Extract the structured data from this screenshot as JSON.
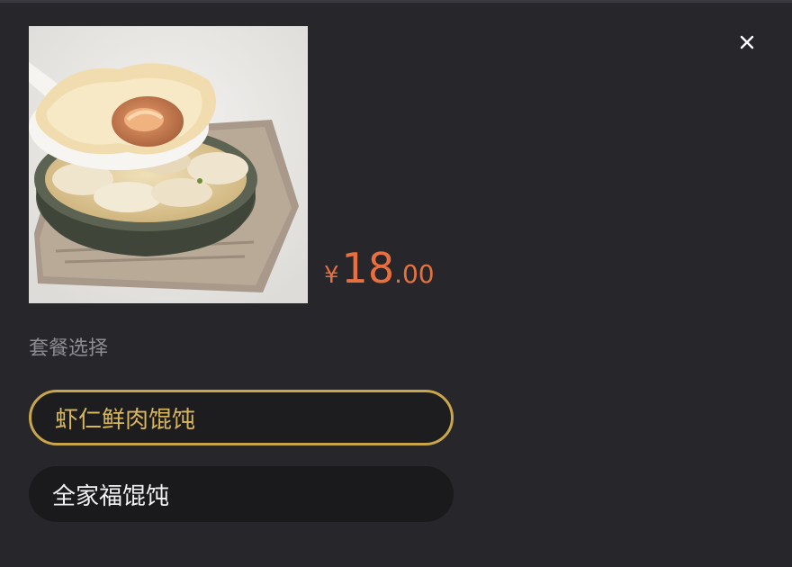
{
  "dialog": {
    "close_icon": "close-icon"
  },
  "product": {
    "image_icon": "wonton-soup-photo",
    "price": {
      "currency": "¥",
      "integer": "18",
      "decimal": ".00"
    }
  },
  "package": {
    "label": "套餐选择",
    "options": [
      {
        "label": "虾仁鲜肉馄饨",
        "selected": true
      },
      {
        "label": "全家福馄饨",
        "selected": false
      }
    ]
  },
  "colors": {
    "background": "#26262b",
    "price": "#e8703e",
    "selected_border": "#c9a64a",
    "selected_text": "#d8b65c"
  }
}
